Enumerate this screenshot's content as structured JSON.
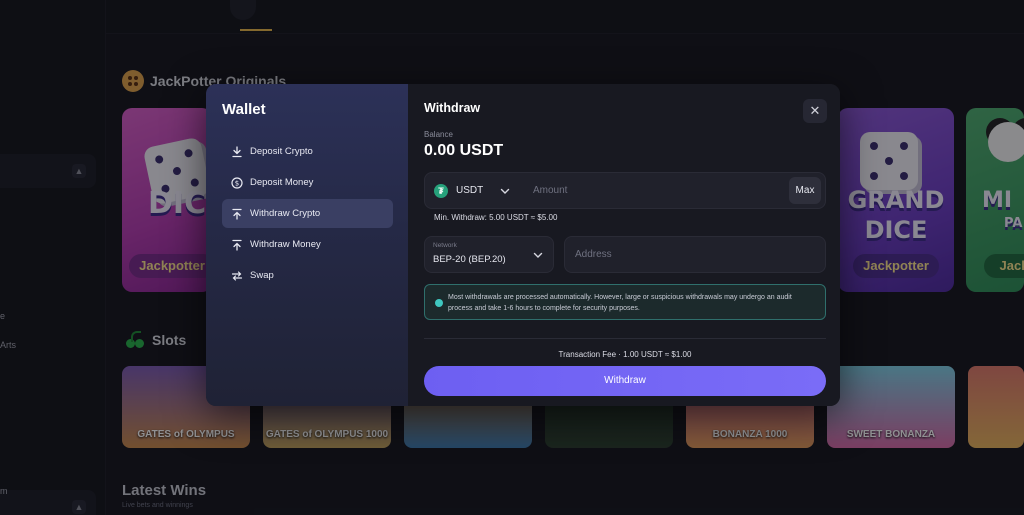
{
  "background": {
    "sections": {
      "originals_title": "JackPotter Originals",
      "slots_title": "Slots",
      "latest_wins_title": "Latest Wins",
      "latest_wins_subtitle": "Live bets and winnings"
    },
    "sidebar_fragments": [
      "e",
      "Arts",
      "m"
    ],
    "originals_cards": [
      {
        "title": "DIC",
        "button": "Jackpotter"
      },
      {
        "title_line1": "GRAND",
        "title_line2": "DICE",
        "button": "Jackpotter"
      },
      {
        "title_line1": "MI",
        "title_line2": "PA",
        "button": "Jack"
      }
    ],
    "slot_labels": [
      "GATES of OLYMPUS",
      "GATES of OLYMPUS 1000",
      "",
      "",
      "BONANZA 1000",
      "SWEET BONANZA",
      ""
    ]
  },
  "wallet": {
    "title": "Wallet",
    "menu": [
      {
        "label": "Deposit Crypto",
        "icon": "download-icon",
        "active": false
      },
      {
        "label": "Deposit Money",
        "icon": "dollar-icon",
        "active": false
      },
      {
        "label": "Withdraw Crypto",
        "icon": "upload-icon",
        "active": true
      },
      {
        "label": "Withdraw Money",
        "icon": "upload-icon",
        "active": false
      },
      {
        "label": "Swap",
        "icon": "swap-icon",
        "active": false
      }
    ]
  },
  "withdraw": {
    "title": "Withdraw",
    "close_icon": "close-icon",
    "balance_label": "Balance",
    "balance_value": "0.00 USDT",
    "currency": "USDT",
    "amount_placeholder": "Amount",
    "max_label": "Max",
    "min_withdraw": "Min. Withdraw: 5.00 USDT ≈ $5.00",
    "network_label": "Network",
    "network_value": "BEP-20 (BEP.20)",
    "address_placeholder": "Address",
    "notice": "Most withdrawals are processed automatically. However, large or suspicious withdrawals may undergo an audit process and take 1-6 hours to complete for security purposes.",
    "fee": "Transaction Fee · 1.00 USDT ≈ $1.00",
    "button_label": "Withdraw"
  },
  "colors": {
    "accent": "#6d5ff2",
    "tether": "#26a17b",
    "notice_border": "#2f6f6c"
  }
}
